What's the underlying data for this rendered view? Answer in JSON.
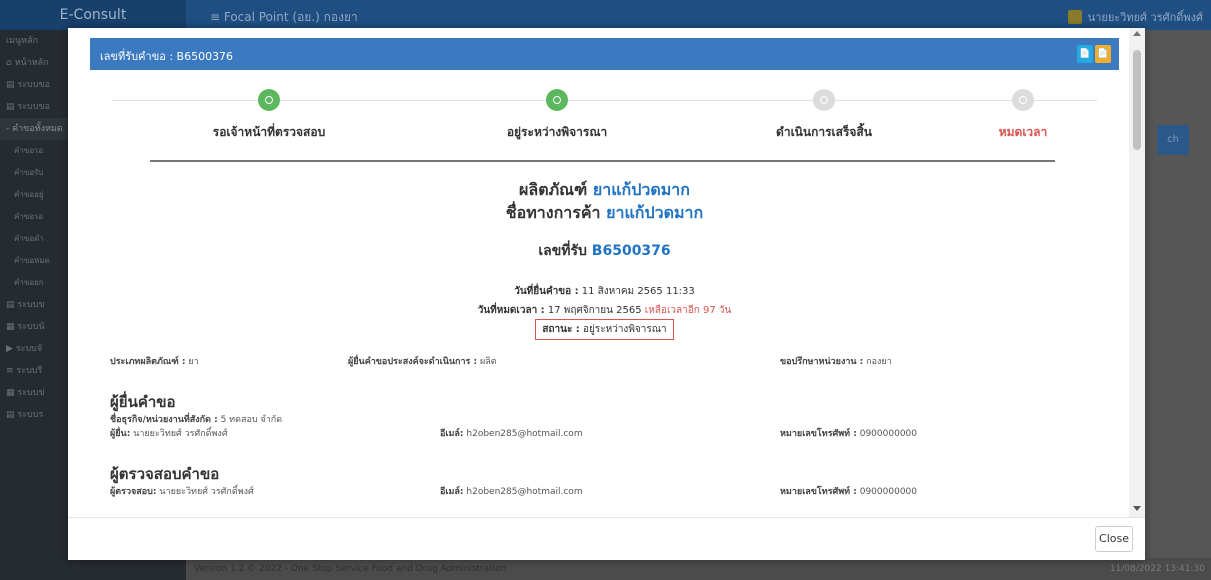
{
  "background": {
    "brand": "E-Consult",
    "topbar_title": "≡  Focal Point (อย.) กองยา",
    "user_name": "นายยะวิทยศ์ วรศักดิ์พงศ์",
    "sidebar": [
      {
        "label": "เมนูหลัก"
      },
      {
        "label": "⌂ หน้าหลัก"
      },
      {
        "label": "▤ ระบบขอ"
      },
      {
        "label": "▤ ระบบขอ"
      },
      {
        "label": "- คำขอทั้งหมด"
      },
      {
        "label": "คำขอรอ"
      },
      {
        "label": "คำขอรับ"
      },
      {
        "label": "คำขออยู่"
      },
      {
        "label": "คำขอรอ"
      },
      {
        "label": "คำขอดำ"
      },
      {
        "label": "คำขอหมด"
      },
      {
        "label": "คำขอยก"
      },
      {
        "label": "▤ ระบบข"
      },
      {
        "label": "▦ ระบบนั"
      },
      {
        "label": "▶ ระบบจั"
      },
      {
        "label": "≡ ระบบรี"
      },
      {
        "label": "▦ ระบบข่"
      },
      {
        "label": "▤ ระบบร"
      }
    ],
    "footer_text": "Version 1.2 © 2022 - One Stop Service Food and Drug Administration",
    "footer_time": "11/08/2022 13:41:30",
    "search_button": "ch"
  },
  "modal": {
    "title": "เลขที่รับคำขอ : B6500376",
    "header_buttons": [
      "📄",
      "📄"
    ],
    "close_label": "Close",
    "steps": [
      {
        "label": "รอเจ้าหน้าที่ตรวจสอบ",
        "state": "done"
      },
      {
        "label": "อยู่ระหว่างพิจารณา",
        "state": "done"
      },
      {
        "label": "ดำเนินการเสร็จสิ้น",
        "state": "todo"
      },
      {
        "label": "หมดเวลา",
        "state": "todo"
      }
    ],
    "product_label": "ผลิตภัณฑ์",
    "product_value": "ยาแก้ปวดมาก",
    "trade_label": "ชื่อทางการค้า",
    "trade_value": "ยาแก้ปวดมาก",
    "receive_label": "เลขที่รับ",
    "receive_value": "B6500376",
    "submit_date_label": "วันที่ยื่นคำขอ :",
    "submit_date_value": "11 สิงหาคม 2565 11:33",
    "expire_date_label": "วันที่หมดเวลา :",
    "expire_date_value": "17 พฤศจิกายน 2565",
    "remaining_text": "เหลือเวลาอีก 97 วัน",
    "status_label": "สถานะ :",
    "status_value": "อยู่ระหว่างพิจารณา",
    "info_row": {
      "product_type_label": "ประเภทผลิตภัณฑ์ :",
      "product_type_value": "ยา",
      "purpose_label": "ผู้ยื่นคำขอประสงค์จะดำเนินการ :",
      "purpose_value": "ผลิต",
      "agency_label": "ขอปรึกษาหน่วยงาน :",
      "agency_value": "กองยา"
    },
    "applicant": {
      "section_title": "ผู้ยื่นคำขอ",
      "company_label": "ชื่อธุรกิจ/หน่วยงานที่สังกัด :",
      "company_value": "5 ทดสอบ จำกัด",
      "name_label": "ผู้ยื่น:",
      "name_value": "นายยะวิทยศ์ วรศักดิ์พงศ์",
      "email_label": "อีเมล์:",
      "email_value": "h2oben285@hotmail.com",
      "phone_label": "หมายเลขโทรศัพท์ :",
      "phone_value": "0900000000"
    },
    "reviewer": {
      "section_title": "ผู้ตรวจสอบคำขอ",
      "name_label": "ผู้ตรวจสอบ:",
      "name_value": "นายยะวิทยศ์ วรศักดิ์พงศ์",
      "email_label": "อีเมล์:",
      "email_value": "h2oben285@hotmail.com",
      "phone_label": "หมายเลขโทรศัพท์ :",
      "phone_value": "0900000000"
    }
  }
}
